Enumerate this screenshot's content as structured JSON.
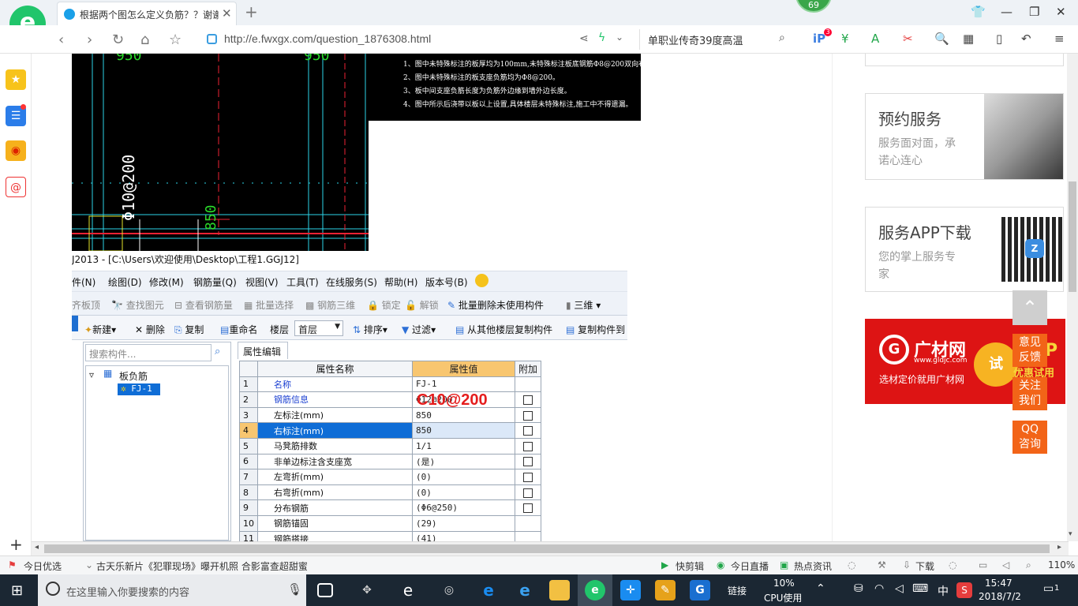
{
  "browser": {
    "tab_title": "根据两个图怎么定义负筋？？谢谢",
    "badge_count": "69",
    "url": "http://e.fwxgx.com/question_1876308.html",
    "search_query": "单职业传奇39度高温",
    "toolbar_badge": "3"
  },
  "cad": {
    "dim_top_left": "950",
    "dim_top_right": "950",
    "rebar_label": "Φ10@200",
    "dim_850": "850",
    "notes": [
      "1、图中未特殊标注的板厚均为100mm,未特殊标注板底钢筋Φ8@200双向布置。",
      "2、图中未特殊标注的板支座负筋均为Φ8@200。",
      "3、板中间支座负筋长度为负筋外边缘到墙外边长度。",
      "4、图中所示后浇带以板以上设置,具体楼层未特殊标注,施工中不得遗漏。"
    ]
  },
  "software": {
    "window_title": "J2013 - [C:\\Users\\欢迎使用\\Desktop\\工程1.GGJ12]",
    "menu": [
      "件(N)",
      "绘图(D)",
      "修改(M)",
      "钢筋量(Q)",
      "视图(V)",
      "工具(T)",
      "在线服务(S)",
      "帮助(H)",
      "版本号(B)"
    ],
    "toolbar1": [
      "齐板顶",
      "查找图元",
      "查看钢筋量",
      "批量选择",
      "钢筋三维",
      "锁定",
      "解锁",
      "批量删除未使用构件",
      "三维"
    ],
    "toolbar2": {
      "new": "新建",
      "delete": "删除",
      "copy": "复制",
      "rename": "重命名",
      "floor_label": "楼层",
      "floor_value": "首层",
      "sort": "排序",
      "filter": "过滤",
      "copy_from_floor": "从其他楼层复制构件",
      "copy_to": "复制构件到"
    },
    "search_placeholder": "搜索构件...",
    "tree": {
      "parent": "板负筋",
      "child": "FJ-1"
    },
    "prop_tab": "属性编辑",
    "table_headers": [
      "属性名称",
      "属性值",
      "附加"
    ],
    "rows": [
      {
        "n": "1",
        "name": "名称",
        "value": "FJ-1",
        "check": false,
        "blue": true
      },
      {
        "n": "2",
        "name": "钢筋信息",
        "value": "Φ12@200",
        "check": true,
        "blue": true
      },
      {
        "n": "3",
        "name": "左标注(mm)",
        "value": "850",
        "check": true,
        "blue": false
      },
      {
        "n": "4",
        "name": "右标注(mm)",
        "value": "850",
        "check": true,
        "blue": false
      },
      {
        "n": "5",
        "name": "马凳筋排数",
        "value": "1/1",
        "check": true,
        "blue": false
      },
      {
        "n": "6",
        "name": "非单边标注含支座宽",
        "value": "(是)",
        "check": true,
        "blue": false
      },
      {
        "n": "7",
        "name": "左弯折(mm)",
        "value": "(0)",
        "check": true,
        "blue": false
      },
      {
        "n": "8",
        "name": "右弯折(mm)",
        "value": "(0)",
        "check": true,
        "blue": false
      },
      {
        "n": "9",
        "name": "分布钢筋",
        "value": "(Φ6@250)",
        "check": true,
        "blue": false
      },
      {
        "n": "10",
        "name": "钢筋锚固",
        "value": "(29)",
        "check": false,
        "blue": false
      },
      {
        "n": "11",
        "name": "钢筋搭接",
        "value": "(41)",
        "check": false,
        "blue": false
      }
    ],
    "red_annotation": "C10@200"
  },
  "sidebar_right": {
    "card1": {
      "title": "预约服务",
      "sub1": "服务面对面，承",
      "sub2": "诺心连心"
    },
    "card2": {
      "title": "服务APP下载",
      "sub1": "您的掌上服务专",
      "sub2": "家"
    },
    "ad": {
      "brand": "广材网",
      "site": "www.gldjc.com",
      "slogan": "选材定价就用广材网",
      "try": "试",
      "promo": "P",
      "promo2": "优惠试用"
    },
    "float_buttons": [
      {
        "l1": "意见",
        "l2": "反馈"
      },
      {
        "l1": "关注",
        "l2": "我们"
      },
      {
        "l1": "QQ",
        "l2": "咨询"
      }
    ]
  },
  "statusbar": {
    "left1": "今日优选",
    "news": "古天乐新片《犯罪现场》曝开机照 合影富查超甜蜜",
    "items": [
      "快剪辑",
      "今日直播",
      "热点资讯"
    ],
    "download": "下载",
    "zoom": "110%"
  },
  "taskbar": {
    "search_placeholder": "在这里输入你要搜索的内容",
    "link": "链接",
    "cpu_value": "10%",
    "cpu_label": "CPU使用",
    "ime": "中",
    "time": "15:47",
    "date": "2018/7/2",
    "notif": "1"
  }
}
